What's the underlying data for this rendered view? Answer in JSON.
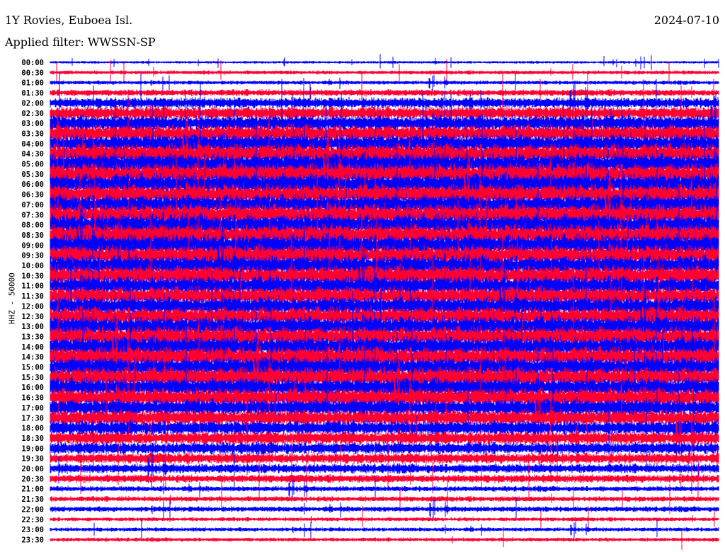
{
  "header": {
    "title": "1Y Rovies, Euboea Isl.",
    "filter": "Applied filter: WWSSN-SP",
    "date": "2024-07-10"
  },
  "chart_data": {
    "type": "line",
    "title": "1Y Rovies, Euboea Isl.",
    "subtitle": "Applied filter: WWSSN-SP",
    "ylabel": "HHZ - 50000",
    "xlabel": "",
    "colors": [
      "#0000ff",
      "#ff0033"
    ],
    "row_labels": [
      "00:00",
      "00:30",
      "01:00",
      "01:30",
      "02:00",
      "02:30",
      "03:00",
      "03:30",
      "04:00",
      "04:30",
      "05:00",
      "05:30",
      "06:00",
      "06:30",
      "07:00",
      "07:30",
      "08:00",
      "08:30",
      "09:00",
      "09:30",
      "10:00",
      "10:30",
      "11:00",
      "11:30",
      "12:00",
      "12:30",
      "13:00",
      "13:30",
      "14:00",
      "14:30",
      "15:00",
      "15:30",
      "16:00",
      "16:30",
      "17:00",
      "17:30",
      "18:00",
      "18:30",
      "19:00",
      "19:30",
      "20:00",
      "20:30",
      "21:00",
      "21:30",
      "22:00",
      "22:30",
      "23:00",
      "23:30"
    ],
    "relative_amplitude": [
      0.2,
      0.3,
      0.3,
      0.5,
      0.8,
      1.0,
      1.2,
      1.3,
      1.4,
      1.5,
      1.6,
      1.6,
      1.6,
      1.5,
      1.5,
      1.6,
      1.6,
      1.6,
      1.6,
      1.5,
      1.5,
      1.5,
      1.4,
      1.4,
      1.4,
      1.4,
      1.5,
      1.5,
      1.5,
      1.5,
      1.5,
      1.5,
      1.4,
      1.4,
      1.3,
      1.2,
      1.1,
      1.0,
      0.9,
      0.8,
      0.7,
      0.6,
      0.4,
      0.4,
      0.4,
      0.3,
      0.3,
      0.3
    ]
  }
}
